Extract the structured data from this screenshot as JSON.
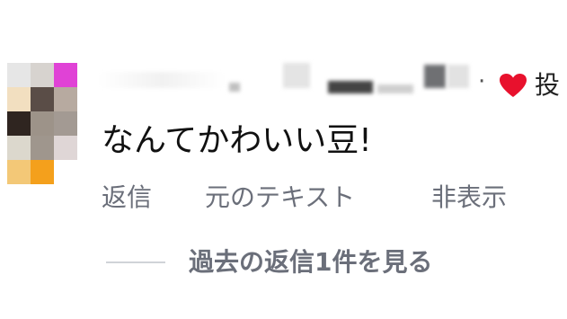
{
  "comment": {
    "text": "なんてかわいい豆!",
    "post_label": "投",
    "separator": "·",
    "heart_color": "#e8112d"
  },
  "actions": {
    "reply": "返信",
    "original_text": "元のテキスト",
    "hide": "非表示"
  },
  "replies": {
    "view_label": "過去の返信1件を見る"
  },
  "avatar": {
    "pixel_colors": [
      [
        "#e6e6e6",
        "#d7d3cf",
        "#e042d6"
      ],
      [
        "#f2dfc0",
        "#5a4d47",
        "#b7aaa0"
      ],
      [
        "#2f2520",
        "#9d9389",
        "#a39a93"
      ],
      [
        "#dcd8cd",
        "#9f968d",
        "#dfd6d6"
      ],
      [
        "#f3c877",
        "#f4a01c",
        "#ffffff"
      ]
    ]
  },
  "icons": {
    "heart": "heart-icon"
  }
}
